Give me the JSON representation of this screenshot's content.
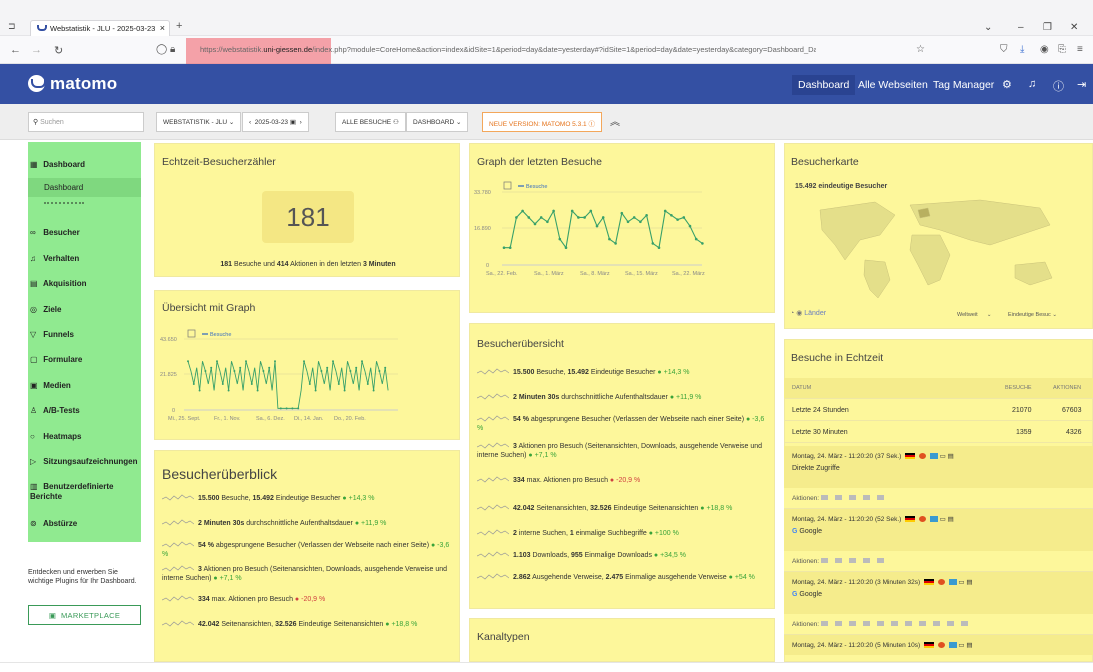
{
  "browser": {
    "tab_title": "Webstatistik - JLU - 2025-03-23",
    "url_prefix": "https://webstatistik.",
    "url_domain": "uni-giessen.de",
    "url_path": "/index.php?module=CoreHome&action=index&idSite=1&period=day&date=yesterday#?idSite=1&period=day&date=yesterday&category=Dashboard_Dashboard&subcat"
  },
  "header": {
    "logo": "matomo",
    "nav": [
      "Dashboard",
      "Alle Webseiten",
      "Tag Manager"
    ]
  },
  "toolbar": {
    "search_placeholder": "Suchen",
    "site": "WEBSTATISTIK - JLU",
    "date": "2025-03-23",
    "segment": "ALLE BESUCHE",
    "dashboard": "DASHBOARD",
    "new_version": "NEUE VERSION: MATOMO 5.3.1"
  },
  "sidebar": {
    "items": [
      "Dashboard",
      "Besucher",
      "Verhalten",
      "Akquisition",
      "Ziele",
      "Funnels",
      "Formulare",
      "Medien",
      "A/B-Tests",
      "Heatmaps",
      "Sitzungsaufzeichnungen",
      "Benutzerdefinierte Berichte",
      "Abstürze"
    ],
    "sub": "Dashboard",
    "promo": "Entdecken und erwerben Sie wichtige Plugins für Ihr Dashboard.",
    "market": "MARKETPLACE"
  },
  "realtime": {
    "title": "Echtzeit-Besucherzähler",
    "count": "181",
    "visits": "181",
    "visits_label": "Besuche",
    "and": "und",
    "actions": "414",
    "actions_label": "Aktionen",
    "in_last": "in den letzten",
    "minutes": "3 Minuten"
  },
  "graph_recent": {
    "title": "Graph der letzten Besuche",
    "legend": "Besuche",
    "y": [
      "33.780",
      "16.890",
      "0"
    ],
    "x": [
      "Sa., 22. Feb.",
      "Sa., 1. März",
      "Sa., 8. März",
      "Sa., 15. März",
      "Sa., 22. März"
    ]
  },
  "graph_overview": {
    "title": "Übersicht mit Graph",
    "legend": "Besuche",
    "y": [
      "43.650",
      "21.825",
      "0"
    ],
    "x": [
      "Mi., 25. Sept.",
      "Fr., 1. Nov.",
      "Sa., 6. Dez.",
      "Di., 14. Jan.",
      "Do., 20. Feb."
    ]
  },
  "map": {
    "title": "Besucherkarte",
    "unique": "15.492 eindeutige Besucher",
    "region": "Länder",
    "scope": "Weltweit",
    "metric": "Eindeutige Besuc"
  },
  "summary_left": {
    "title": "Besucherüberblick",
    "rows": [
      {
        "b": "15.500",
        "t": " Besuche, ",
        "b2": "15.492",
        "t2": " Eindeutige Besucher",
        "d": "+14,3 %",
        "p": true
      },
      {
        "b": "2 Minuten 30s",
        "t": " durchschnittliche Aufenthaltsdauer",
        "b2": "",
        "t2": "",
        "d": "+11,9 %",
        "p": true
      },
      {
        "b": "54 %",
        "t": " abgesprungene Besucher (Verlassen der Webseite nach einer Seite)",
        "b2": "",
        "t2": "",
        "d": "-3,6 %",
        "p": true
      },
      {
        "b": "3",
        "t": " Aktionen pro Besuch (Seitenansichten, Downloads, ausgehende Verweise und interne Suchen)",
        "b2": "",
        "t2": "",
        "d": "+7,1 %",
        "p": true
      },
      {
        "b": "334",
        "t": " max. Aktionen pro Besuch",
        "b2": "",
        "t2": "",
        "d": "-20,9 %",
        "p": false
      },
      {
        "b": "42.042",
        "t": " Seitenansichten, ",
        "b2": "32.526",
        "t2": " Eindeutige Seitenansichten",
        "d": "+18,8 %",
        "p": true
      }
    ]
  },
  "summary_mid": {
    "title": "Besucherübersicht",
    "rows": [
      {
        "b": "15.500",
        "t": " Besuche, ",
        "b2": "15.492",
        "t2": " Eindeutige Besucher",
        "d": "+14,3 %",
        "p": true
      },
      {
        "b": "2 Minuten 30s",
        "t": " durchschnittliche Aufenthaltsdauer",
        "b2": "",
        "t2": "",
        "d": "+11,9 %",
        "p": true
      },
      {
        "b": "54 %",
        "t": " abgesprungene Besucher (Verlassen der Webseite nach einer Seite)",
        "b2": "",
        "t2": "",
        "d": "-3,6 %",
        "p": true
      },
      {
        "b": "3",
        "t": " Aktionen pro Besuch (Seitenansichten, Downloads, ausgehende Verweise und interne Suchen)",
        "b2": "",
        "t2": "",
        "d": "+7,1 %",
        "p": true
      },
      {
        "b": "334",
        "t": " max. Aktionen pro Besuch",
        "b2": "",
        "t2": "",
        "d": "-20,9 %",
        "p": false
      },
      {
        "b": "42.042",
        "t": " Seitenansichten, ",
        "b2": "32.526",
        "t2": " Eindeutige Seitenansichten",
        "d": "+18,8 %",
        "p": true
      },
      {
        "b": "2",
        "t": " interne Suchen, ",
        "b2": "1",
        "t2": " einmalige Suchbegriffe",
        "d": "+100 %",
        "p": true
      },
      {
        "b": "1.103",
        "t": " Downloads, ",
        "b2": "955",
        "t2": " Einmalige Downloads",
        "d": "+34,5 %",
        "p": true
      },
      {
        "b": "2.862",
        "t": " Ausgehende Verweise, ",
        "b2": "2.475",
        "t2": " Einmalige ausgehende Verweise",
        "d": "+54 %",
        "p": true
      }
    ]
  },
  "channels": {
    "title": "Kanaltypen"
  },
  "live": {
    "title": "Besuche in Echtzeit",
    "head": [
      "DATUM",
      "BESUCHE",
      "AKTIONEN"
    ],
    "rows": [
      [
        "Letzte 24 Stunden",
        "21070",
        "67603"
      ],
      [
        "Letzte 30 Minuten",
        "1359",
        "4326"
      ]
    ],
    "visits": [
      {
        "time": "Montag, 24. März - 11:20:20 (37 Sek.)",
        "ref": "Direkte Zugriffe",
        "n": 5
      },
      {
        "time": "Montag, 24. März - 11:20:20 (52 Sek.)",
        "ref": "Google",
        "n": 5
      },
      {
        "time": "Montag, 24. März - 11:20:20 (3 Minuten 32s)",
        "ref": "Google",
        "n": 11
      },
      {
        "time": "Montag, 24. März - 11:20:20 (5 Minuten 10s)",
        "ref": "",
        "n": 0
      }
    ],
    "actions_label": "Aktionen:"
  },
  "colors": {
    "yellow": "#fdf79b",
    "green": "#90ea90",
    "header": "#3450a3",
    "highlight": "#f05a64"
  }
}
